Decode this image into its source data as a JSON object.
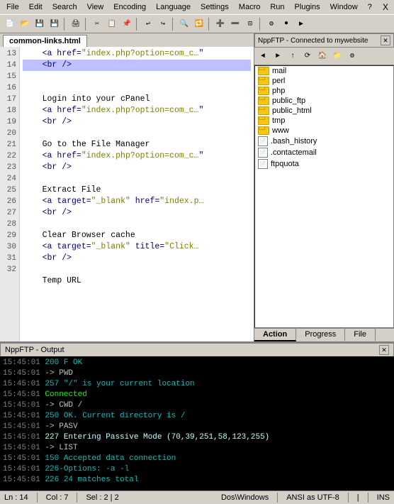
{
  "menubar": {
    "items": [
      "File",
      "Edit",
      "Search",
      "View",
      "Encoding",
      "Language",
      "Settings",
      "Macro",
      "Run",
      "Plugins",
      "Window",
      "?"
    ],
    "close": "X"
  },
  "editor": {
    "tab_label": "common-links.html",
    "lines": [
      {
        "num": 13,
        "content": "    <a href=\"index.php?option=com_c…",
        "tags": true
      },
      {
        "num": 14,
        "content": "    <br />",
        "tags": true,
        "highlight": true
      },
      {
        "num": 15,
        "content": ""
      },
      {
        "num": 16,
        "content": "    Login into your cPanel",
        "tags": false
      },
      {
        "num": 17,
        "content": "    <a href=\"index.php?option=com_c…",
        "tags": true
      },
      {
        "num": 18,
        "content": "    <br />",
        "tags": true
      },
      {
        "num": 19,
        "content": ""
      },
      {
        "num": 20,
        "content": "    Go to the File Manager",
        "tags": false
      },
      {
        "num": 21,
        "content": "    <a href=\"index.php?option=com_c…",
        "tags": true
      },
      {
        "num": 22,
        "content": "    <br />",
        "tags": true
      },
      {
        "num": 23,
        "content": ""
      },
      {
        "num": 24,
        "content": "    Extract File",
        "tags": false
      },
      {
        "num": 25,
        "content": "    <a target=\"_blank\" href=\"index.p…",
        "tags": true
      },
      {
        "num": 26,
        "content": "    <br />",
        "tags": true
      },
      {
        "num": 27,
        "content": ""
      },
      {
        "num": 28,
        "content": "    Clear Browser cache",
        "tags": false
      },
      {
        "num": 29,
        "content": "    <a target=\"_blank\" title=\"Click…",
        "tags": true
      },
      {
        "num": 30,
        "content": "    <br />",
        "tags": true
      },
      {
        "num": 31,
        "content": ""
      },
      {
        "num": 32,
        "content": "    Temp URL",
        "tags": false
      }
    ]
  },
  "ftp": {
    "header": "NppFTP - Connected to mywebsite",
    "toolbar_buttons": [
      "◄",
      "►",
      "↑",
      "⟳",
      "🏠",
      "📁",
      "✎",
      "⚙"
    ],
    "tree_items": [
      {
        "name": "mail",
        "type": "folder"
      },
      {
        "name": "perl",
        "type": "folder"
      },
      {
        "name": "php",
        "type": "folder"
      },
      {
        "name": "public_ftp",
        "type": "folder"
      },
      {
        "name": "public_html",
        "type": "folder"
      },
      {
        "name": "tmp",
        "type": "folder"
      },
      {
        "name": "www",
        "type": "folder"
      },
      {
        "name": ".bash_history",
        "type": "file"
      },
      {
        "name": ".contactemail",
        "type": "file"
      },
      {
        "name": "ftpquota",
        "type": "file"
      }
    ],
    "tabs": [
      "Action",
      "Progress",
      "File"
    ]
  },
  "output": {
    "header": "NppFTP - Output",
    "logs": [
      {
        "time": "15:45:01",
        "msg": "200 F OK",
        "type": "ok"
      },
      {
        "time": "15:45:01",
        "msg": "-> PWD",
        "type": "cmd"
      },
      {
        "time": "15:45:01",
        "msg": "257 \"/\" is your current location",
        "type": "ok"
      },
      {
        "time": "15:45:01",
        "msg": "Connected",
        "type": "connected"
      },
      {
        "time": "15:45:01",
        "msg": "-> CWD /",
        "type": "cmd"
      },
      {
        "time": "15:45:01",
        "msg": "250 OK. Current directory is /",
        "type": "ok"
      },
      {
        "time": "15:45:01",
        "msg": "-> PASV",
        "type": "cmd"
      },
      {
        "time": "15:45:01",
        "msg": "227 Entering Passive Mode (70,39,251,58,123,255)",
        "type": "data"
      },
      {
        "time": "15:45:01",
        "msg": "-> LIST",
        "type": "cmd"
      },
      {
        "time": "15:45:01",
        "msg": "150 Accepted data connection",
        "type": "ok"
      },
      {
        "time": "15:45:01",
        "msg": "226-Options: -a -l",
        "type": "ok"
      },
      {
        "time": "15:45:01",
        "msg": "226 24 matches total",
        "type": "ok"
      }
    ]
  },
  "statusbar": {
    "ln": "Ln : 14",
    "col": "Col : 7",
    "sel": "Sel : 2 | 2",
    "encoding": "Dos\\Windows",
    "charset": "ANSI as UTF-8",
    "ins": "INS"
  }
}
